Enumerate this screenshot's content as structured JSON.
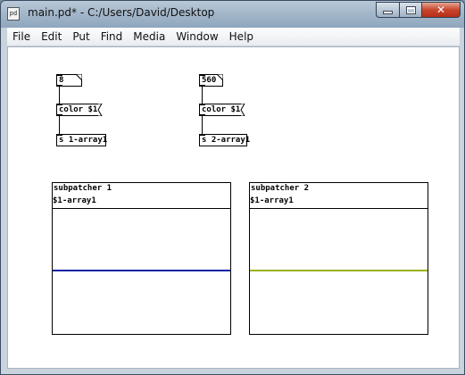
{
  "window": {
    "title": "main.pd* - C:/Users/David/Desktop",
    "app_icon": "pd"
  },
  "menu": [
    "File",
    "Edit",
    "Put",
    "Find",
    "Media",
    "Window",
    "Help"
  ],
  "patch": {
    "col1": {
      "number": "8",
      "message": "color $1",
      "send": "s 1-array1"
    },
    "col2": {
      "number": "560",
      "message": "color $1",
      "send": "s 2-array1"
    }
  },
  "graphs": [
    {
      "name": "subpatcher 1",
      "array": "$1-array1",
      "line_color": "#0a23a6"
    },
    {
      "name": "subpatcher 2",
      "array": "$1-array1",
      "line_color": "#9ab21f"
    }
  ]
}
